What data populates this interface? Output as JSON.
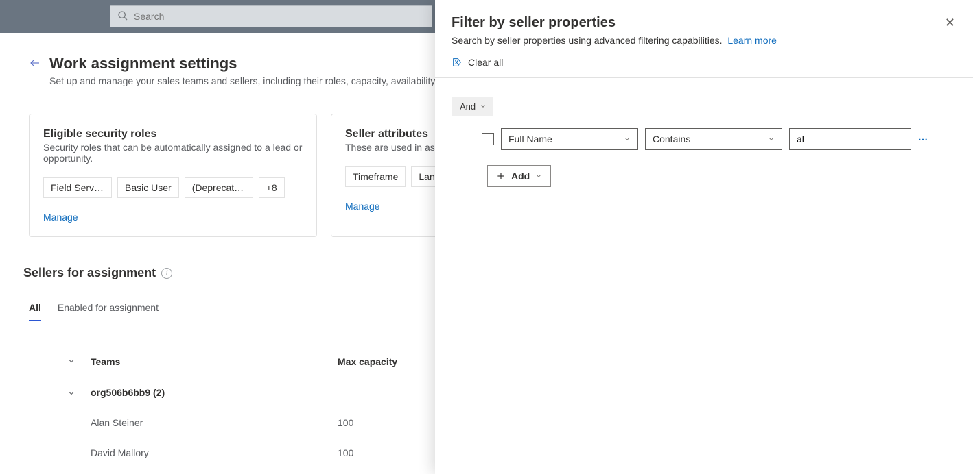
{
  "topbar": {
    "search_placeholder": "Search"
  },
  "page": {
    "title": "Work assignment settings",
    "subtitle": "Set up and manage your sales teams and sellers, including their roles, capacity, availability and more."
  },
  "roles_card": {
    "title": "Eligible security roles",
    "subtitle": "Security roles that can be automatically assigned to a lead or opportunity.",
    "chips": [
      "Field Servic…",
      "Basic User",
      "(Deprecate…",
      "+8"
    ],
    "manage": "Manage"
  },
  "attrs_card": {
    "title": "Seller attributes",
    "subtitle": "These are used in assignment rules.",
    "chips": [
      "Timeframe",
      "Language"
    ],
    "manage": "Manage"
  },
  "sellers": {
    "heading": "Sellers for assignment",
    "tabs": {
      "all": "All",
      "enabled": "Enabled for assignment"
    },
    "columns": {
      "teams": "Teams",
      "capacity": "Max capacity"
    },
    "group": "org506b6bb9 (2)",
    "rows": [
      {
        "name": "Alan Steiner",
        "capacity": "100"
      },
      {
        "name": "David Mallory",
        "capacity": "100"
      }
    ]
  },
  "panel": {
    "title": "Filter by seller properties",
    "subtitle": "Search by seller properties using advanced filtering capabilities.",
    "learn_more": "Learn more",
    "clear_all": "Clear all",
    "group_op": "And",
    "condition": {
      "field": "Full Name",
      "op": "Contains",
      "value": "al"
    },
    "add": "Add"
  }
}
